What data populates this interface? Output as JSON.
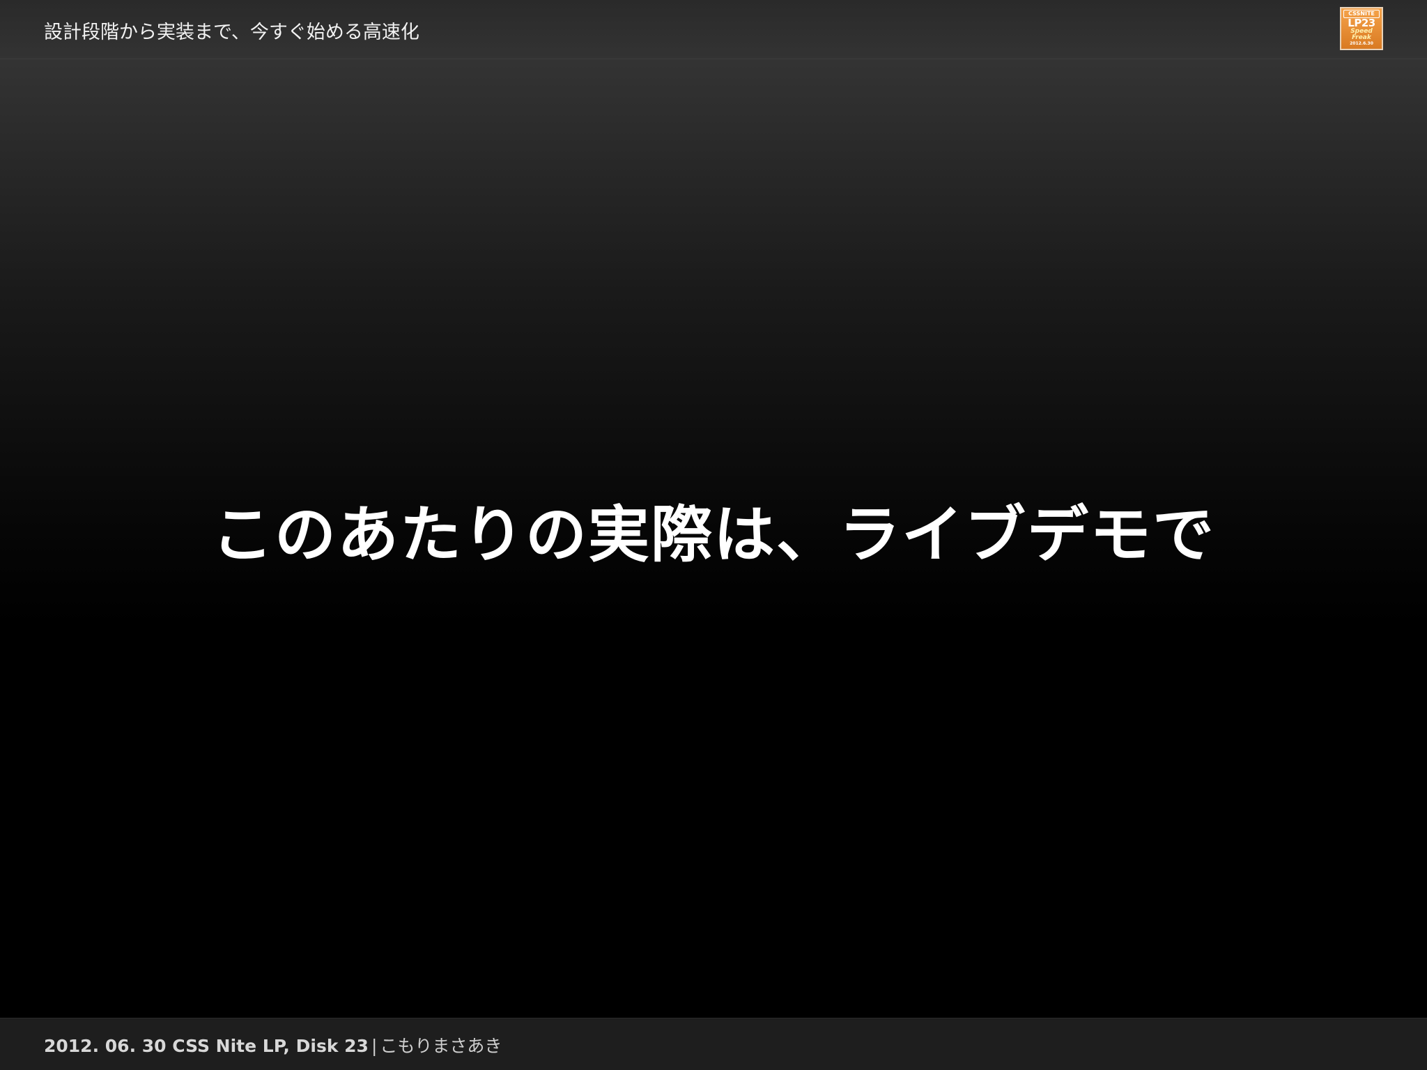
{
  "header": {
    "title": "設計段階から実装まで、今すぐ始める高速化",
    "logo": {
      "line1": "CSSNITE",
      "line2": "LP23",
      "line3": "Speed",
      "line4": "Freak",
      "line5": "2012.6.30"
    }
  },
  "main": {
    "message": "このあたりの実際は、ライブデモで"
  },
  "footer": {
    "event": "2012. 06. 30 CSS Nite LP, Disk 23",
    "separator": "|",
    "author": "こもりまさあき"
  },
  "colors": {
    "logo_orange": "#e8892e",
    "text": "#ffffff",
    "footer_text": "#d0d0d0"
  }
}
